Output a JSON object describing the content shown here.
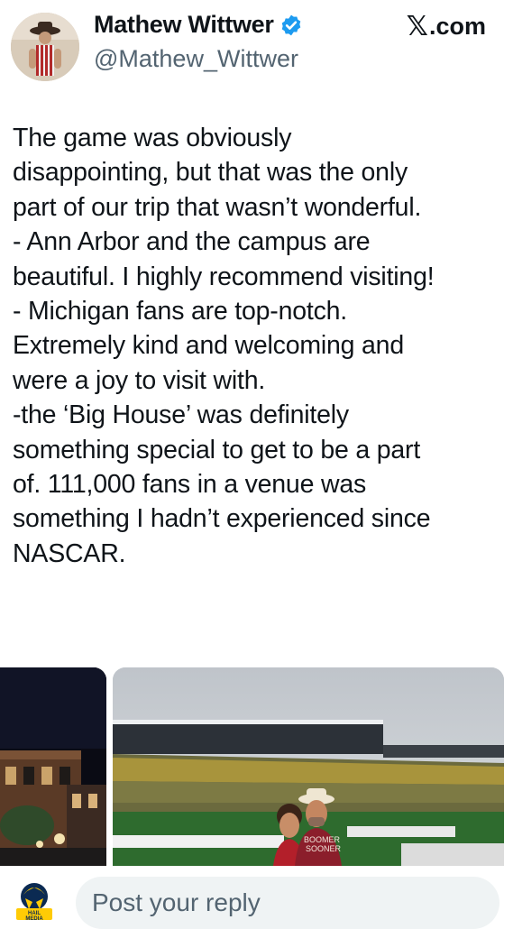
{
  "author": {
    "display_name": "Mathew Wittwer",
    "handle": "@Mathew_Wittwer",
    "verified": true,
    "avatar_icon": "profile-photo"
  },
  "source_label": ".com",
  "source_glyph": "𝕏",
  "tweet_text": "The game was obviously\ndisappointing, but that was the only\npart of our trip that wasn’t wonderful.\n- Ann Arbor and the campus are\nbeautiful. I highly recommend visiting!\n- Michigan fans are top-notch.\nExtremely kind and welcoming and\nwere a joy to visit with.\n-the ‘Big House’ was definitely\nsomething special to get to be a part\nof. 111,000 fans in a venue was\nsomething I hadn’t experienced since\nNASCAR.",
  "media": {
    "photo_left": "night-street-photo",
    "photo_right": "stadium-selfie-photo",
    "shirt_text": "BOOMER\nSOONER"
  },
  "reply": {
    "avatar_icon": "hail-media-logo",
    "avatar_text": "HAIL\nMEDIA",
    "placeholder": "Post your reply"
  },
  "colors": {
    "text": "#0f1419",
    "secondary": "#536471",
    "verified_blue": "#1d9bf0",
    "reply_bg": "#eff3f4"
  }
}
